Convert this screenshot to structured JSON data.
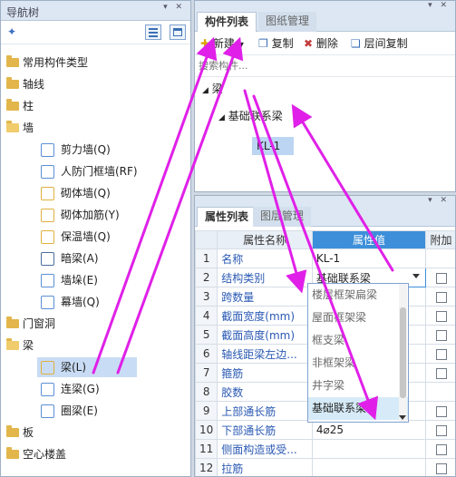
{
  "nav": {
    "title": "导航树",
    "items": [
      {
        "label": "常用构件类型",
        "type": "folder"
      },
      {
        "label": "轴线",
        "type": "folder"
      },
      {
        "label": "柱",
        "type": "folder"
      },
      {
        "label": "墙",
        "type": "folder-open"
      },
      {
        "label": "剪力墙(Q)",
        "type": "child"
      },
      {
        "label": "人防门框墙(RF)",
        "type": "child"
      },
      {
        "label": "砌体墙(Q)",
        "type": "child"
      },
      {
        "label": "砌体加筋(Y)",
        "type": "child"
      },
      {
        "label": "保温墙(Q)",
        "type": "child"
      },
      {
        "label": "暗梁(A)",
        "type": "child"
      },
      {
        "label": "墙垛(E)",
        "type": "child"
      },
      {
        "label": "幕墙(Q)",
        "type": "child"
      },
      {
        "label": "门窗洞",
        "type": "folder"
      },
      {
        "label": "梁",
        "type": "folder-open"
      },
      {
        "label": "梁(L)",
        "type": "child-selected"
      },
      {
        "label": "连梁(G)",
        "type": "child"
      },
      {
        "label": "圈梁(E)",
        "type": "child"
      },
      {
        "label": "板",
        "type": "folder"
      },
      {
        "label": "空心楼盖",
        "type": "folder"
      }
    ]
  },
  "list_panel": {
    "tab_active": "构件列表",
    "tab_inactive": "图纸管理",
    "toolbar": {
      "new": "新建",
      "copy": "复制",
      "delete": "删除",
      "floor_copy": "层间复制"
    },
    "search_placeholder": "搜索构件...",
    "tree_root": "梁",
    "tree_group": "基础联系梁",
    "tree_item": "KL-1"
  },
  "props_panel": {
    "tab_active": "属性列表",
    "tab_inactive": "图层管理",
    "headers": {
      "name": "属性名称",
      "value": "属性值",
      "add": "附加"
    },
    "rows": [
      {
        "num": "1",
        "name": "名称",
        "value": "KL-1",
        "check": false
      },
      {
        "num": "2",
        "name": "结构类别",
        "value": "基础联系梁",
        "check": true
      },
      {
        "num": "3",
        "name": "跨数量",
        "value": "",
        "check": true
      },
      {
        "num": "4",
        "name": "截面宽度(mm)",
        "value": "",
        "check": true
      },
      {
        "num": "5",
        "name": "截面高度(mm)",
        "value": "",
        "check": true
      },
      {
        "num": "6",
        "name": "轴线距梁左边...",
        "value": "",
        "check": true
      },
      {
        "num": "7",
        "name": "箍筋",
        "value": "",
        "check": true
      },
      {
        "num": "8",
        "name": "胶数",
        "value": "",
        "check": false
      },
      {
        "num": "9",
        "name": "上部通长筋",
        "value": "",
        "check": true
      },
      {
        "num": "10",
        "name": "下部通长筋",
        "value": "4⌀25",
        "check": true
      },
      {
        "num": "11",
        "name": "侧面构造或受...",
        "value": "",
        "check": true
      },
      {
        "num": "12",
        "name": "拉筋",
        "value": "",
        "check": true
      }
    ],
    "dropdown_options": [
      "楼层框架扁梁",
      "屋面框架梁",
      "框支梁",
      "非框架梁",
      "井字梁",
      "基础联系梁"
    ],
    "dropdown_selected": "基础联系梁"
  },
  "colors": {
    "accent": "#3d8fd9",
    "selection": "#c9dcf5",
    "link_text": "#2a59b3",
    "annotation_arrow": "#e020e8"
  }
}
